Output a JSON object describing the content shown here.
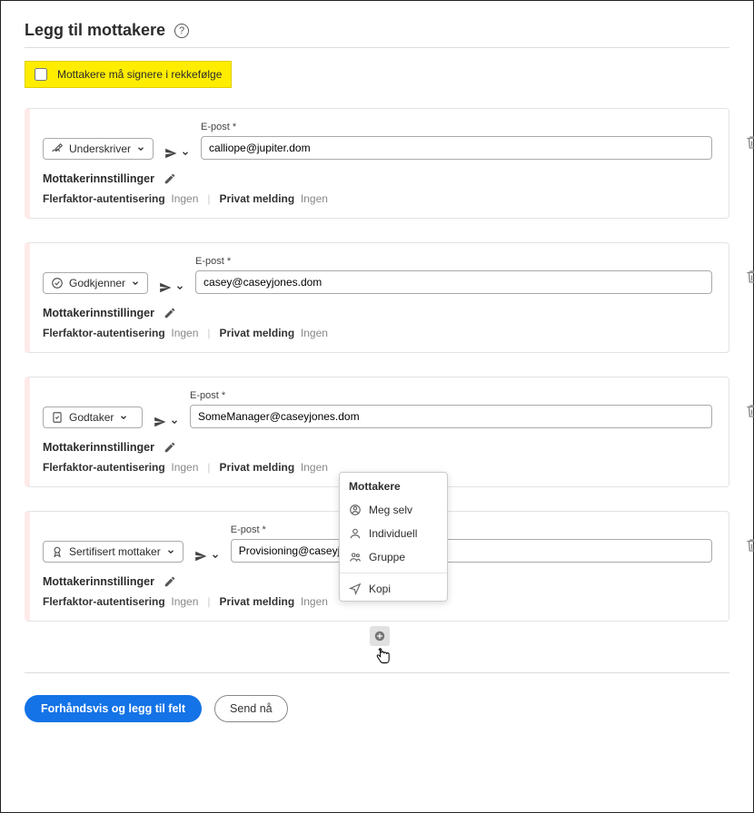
{
  "header": {
    "title": "Legg til mottakere"
  },
  "sign_order": {
    "label": "Mottakere må signere i rekkefølge"
  },
  "common": {
    "email_label": "E-post  *",
    "settings_label": "Mottakerinnstillinger",
    "mfa_label": "Flerfaktor-autentisering",
    "mfa_value": "Ingen",
    "pm_label": "Privat melding",
    "pm_value": "Ingen"
  },
  "recipients": [
    {
      "role": "Underskriver",
      "email": "calliope@jupiter.dom"
    },
    {
      "role": "Godkjenner",
      "email": "casey@caseyjones.dom"
    },
    {
      "role": "Godtaker",
      "email": "SomeManager@caseyjones.dom"
    },
    {
      "role": "Sertifisert mottaker",
      "email": "Provisioning@caseyjones.dom"
    }
  ],
  "popup": {
    "title": "Mottakere",
    "items": [
      "Meg selv",
      "Individuell",
      "Gruppe"
    ],
    "copy": "Kopi"
  },
  "actions": {
    "preview": "Forhåndsvis og legg til felt",
    "send": "Send nå"
  }
}
